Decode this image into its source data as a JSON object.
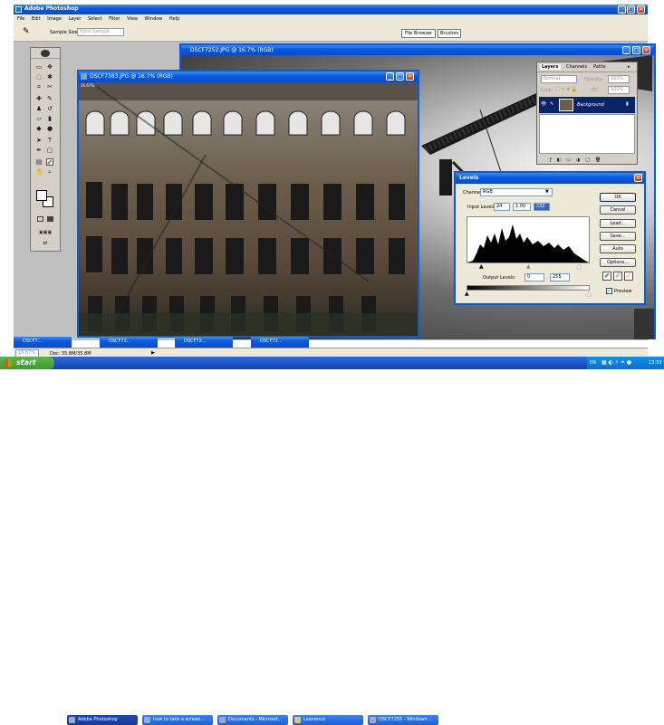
{
  "app": {
    "title": "Adobe Photoshop"
  },
  "menu": [
    "File",
    "Edit",
    "Image",
    "Layer",
    "Select",
    "Filter",
    "View",
    "Window",
    "Help"
  ],
  "options_bar": {
    "label": "Sample Size:",
    "value": "Point Sample"
  },
  "palette_tabs": [
    "File Browser",
    "Brushes"
  ],
  "back_window": {
    "title": "DSCF7252.JPG @ 16.7% (RGB)"
  },
  "front_window": {
    "title": "DSCF7383.JPG @ 16.7% (RGB)",
    "zoom": "16.67%"
  },
  "layers": {
    "tabs": [
      "Layers",
      "Channels",
      "Paths"
    ],
    "blend_mode": "Normal",
    "opacity_label": "Opacity:",
    "opacity": "100%",
    "lock_label": "Lock:",
    "fill_label": "Fill:",
    "fill": "100%",
    "layer_name": "Background"
  },
  "levels": {
    "title": "Levels",
    "channel_label": "Channel:",
    "channel": "RGB",
    "input_label": "Input Levels:",
    "input": [
      "24",
      "1.00",
      "232"
    ],
    "output_label": "Output Levels:",
    "output": [
      "0",
      "255"
    ],
    "buttons": [
      "OK",
      "Cancel",
      "Load...",
      "Save...",
      "Auto",
      "Options..."
    ],
    "preview_label": "Preview",
    "preview_checked": true
  },
  "minimized": [
    "DSCF7...",
    "DSCF72...",
    "DSCF72...",
    "DSCF72..."
  ],
  "status": {
    "zoom": "16.67%",
    "doc": "Doc: 35.8M/35.8M"
  },
  "taskbar": {
    "start": "start",
    "items": [
      "Adobe Photoshop",
      "how to take a screen...",
      "Documents - Microsof...",
      "Lawrence",
      "DSCF7255 - Windows..."
    ],
    "tray_lang": "EN",
    "clock": "13:33"
  },
  "colors": {
    "xp_blue": "#0a5ae0",
    "taskbar": "#245edb",
    "start_green": "#3c9a2f",
    "ps_gray": "#c0c0c0"
  }
}
